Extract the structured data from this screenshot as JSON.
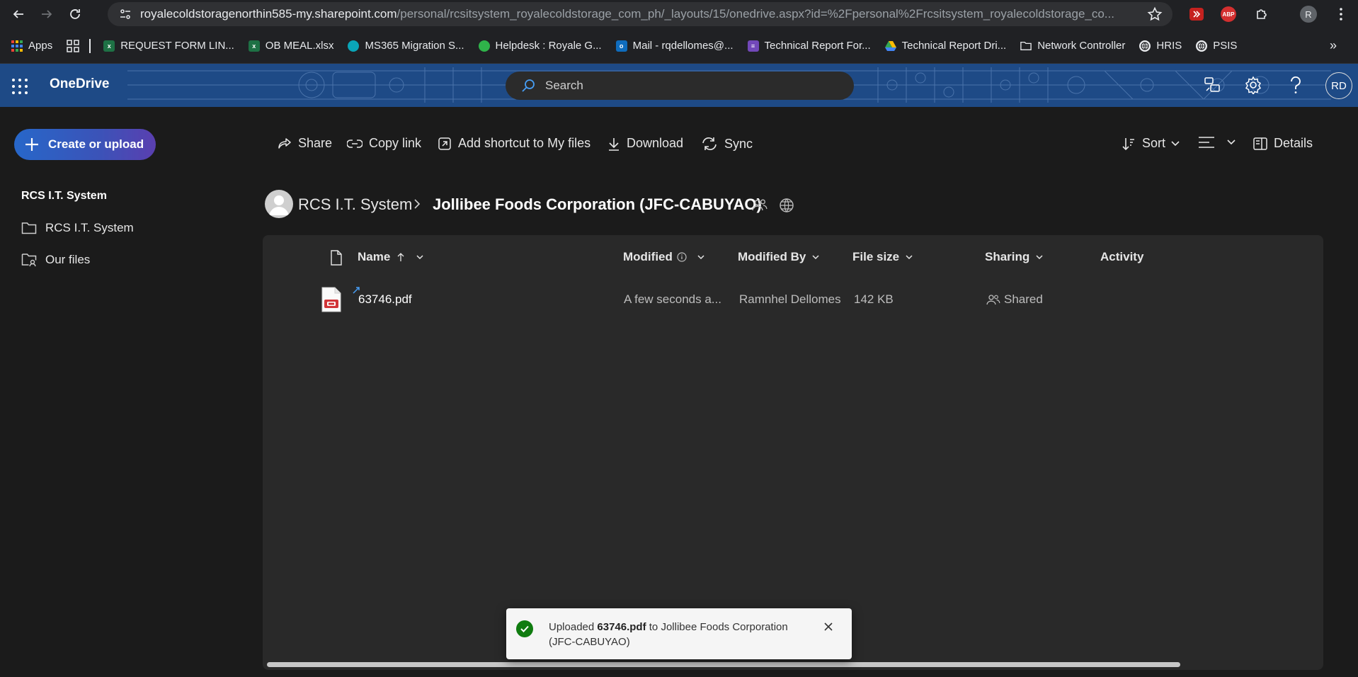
{
  "browser": {
    "url_host": "royalecoldstoragenorthin585-my.sharepoint.com",
    "url_path": "/personal/rcsitsystem_royalecoldstorage_com_ph/_layouts/15/onedrive.aspx?id=%2Fpersonal%2Frcsitsystem_royalecoldstorage_co...",
    "profile_initial": "R",
    "abp_label": "ABP",
    "bookmarks": [
      {
        "label": "Apps",
        "icon": "apps-grid-icon"
      },
      {
        "label": "REQUEST FORM LIN...",
        "icon": "excel-icon"
      },
      {
        "label": "OB MEAL.xlsx",
        "icon": "excel-icon"
      },
      {
        "label": "MS365 Migration S...",
        "icon": "migration-icon"
      },
      {
        "label": "Helpdesk : Royale G...",
        "icon": "headset-icon"
      },
      {
        "label": "Mail - rqdellomes@...",
        "icon": "mail-icon"
      },
      {
        "label": "Technical Report For...",
        "icon": "forms-icon"
      },
      {
        "label": "Technical Report Dri...",
        "icon": "drive-icon"
      },
      {
        "label": "Network Controller",
        "icon": "folder-icon"
      },
      {
        "label": "HRIS",
        "icon": "globe-icon"
      },
      {
        "label": "PSIS",
        "icon": "globe-icon"
      }
    ]
  },
  "header": {
    "app_name": "OneDrive",
    "search_placeholder": "Search",
    "user_initials": "RD"
  },
  "sidebar": {
    "create_label": "Create or upload",
    "section_title": "RCS I.T. System",
    "items": [
      {
        "label": "RCS I.T. System",
        "icon": "folder-icon"
      },
      {
        "label": "Our files",
        "icon": "shared-folder-icon"
      }
    ]
  },
  "commandbar": {
    "share": "Share",
    "copy_link": "Copy link",
    "add_shortcut": "Add shortcut to My files",
    "download": "Download",
    "sync": "Sync",
    "sort": "Sort",
    "details": "Details"
  },
  "breadcrumb": {
    "root": "RCS I.T. System",
    "current": "Jollibee Foods Corporation (JFC-CABUYAO)"
  },
  "columns": {
    "name": "Name",
    "modified": "Modified",
    "modified_by": "Modified By",
    "file_size": "File size",
    "sharing": "Sharing",
    "activity": "Activity"
  },
  "files": [
    {
      "name": "63746.pdf",
      "modified": "A few seconds a...",
      "modified_by": "Ramnhel Dellomes",
      "size": "142 KB",
      "sharing": "Shared"
    }
  ],
  "toast": {
    "prefix": "Uploaded",
    "file": "63746.pdf",
    "middle": "to Jollibee Foods Corporation",
    "line2": "(JFC-CABUYAO)"
  },
  "colors": {
    "accent": "#479ef5",
    "header_blue": "#1e4a86",
    "success": "#107c10"
  }
}
